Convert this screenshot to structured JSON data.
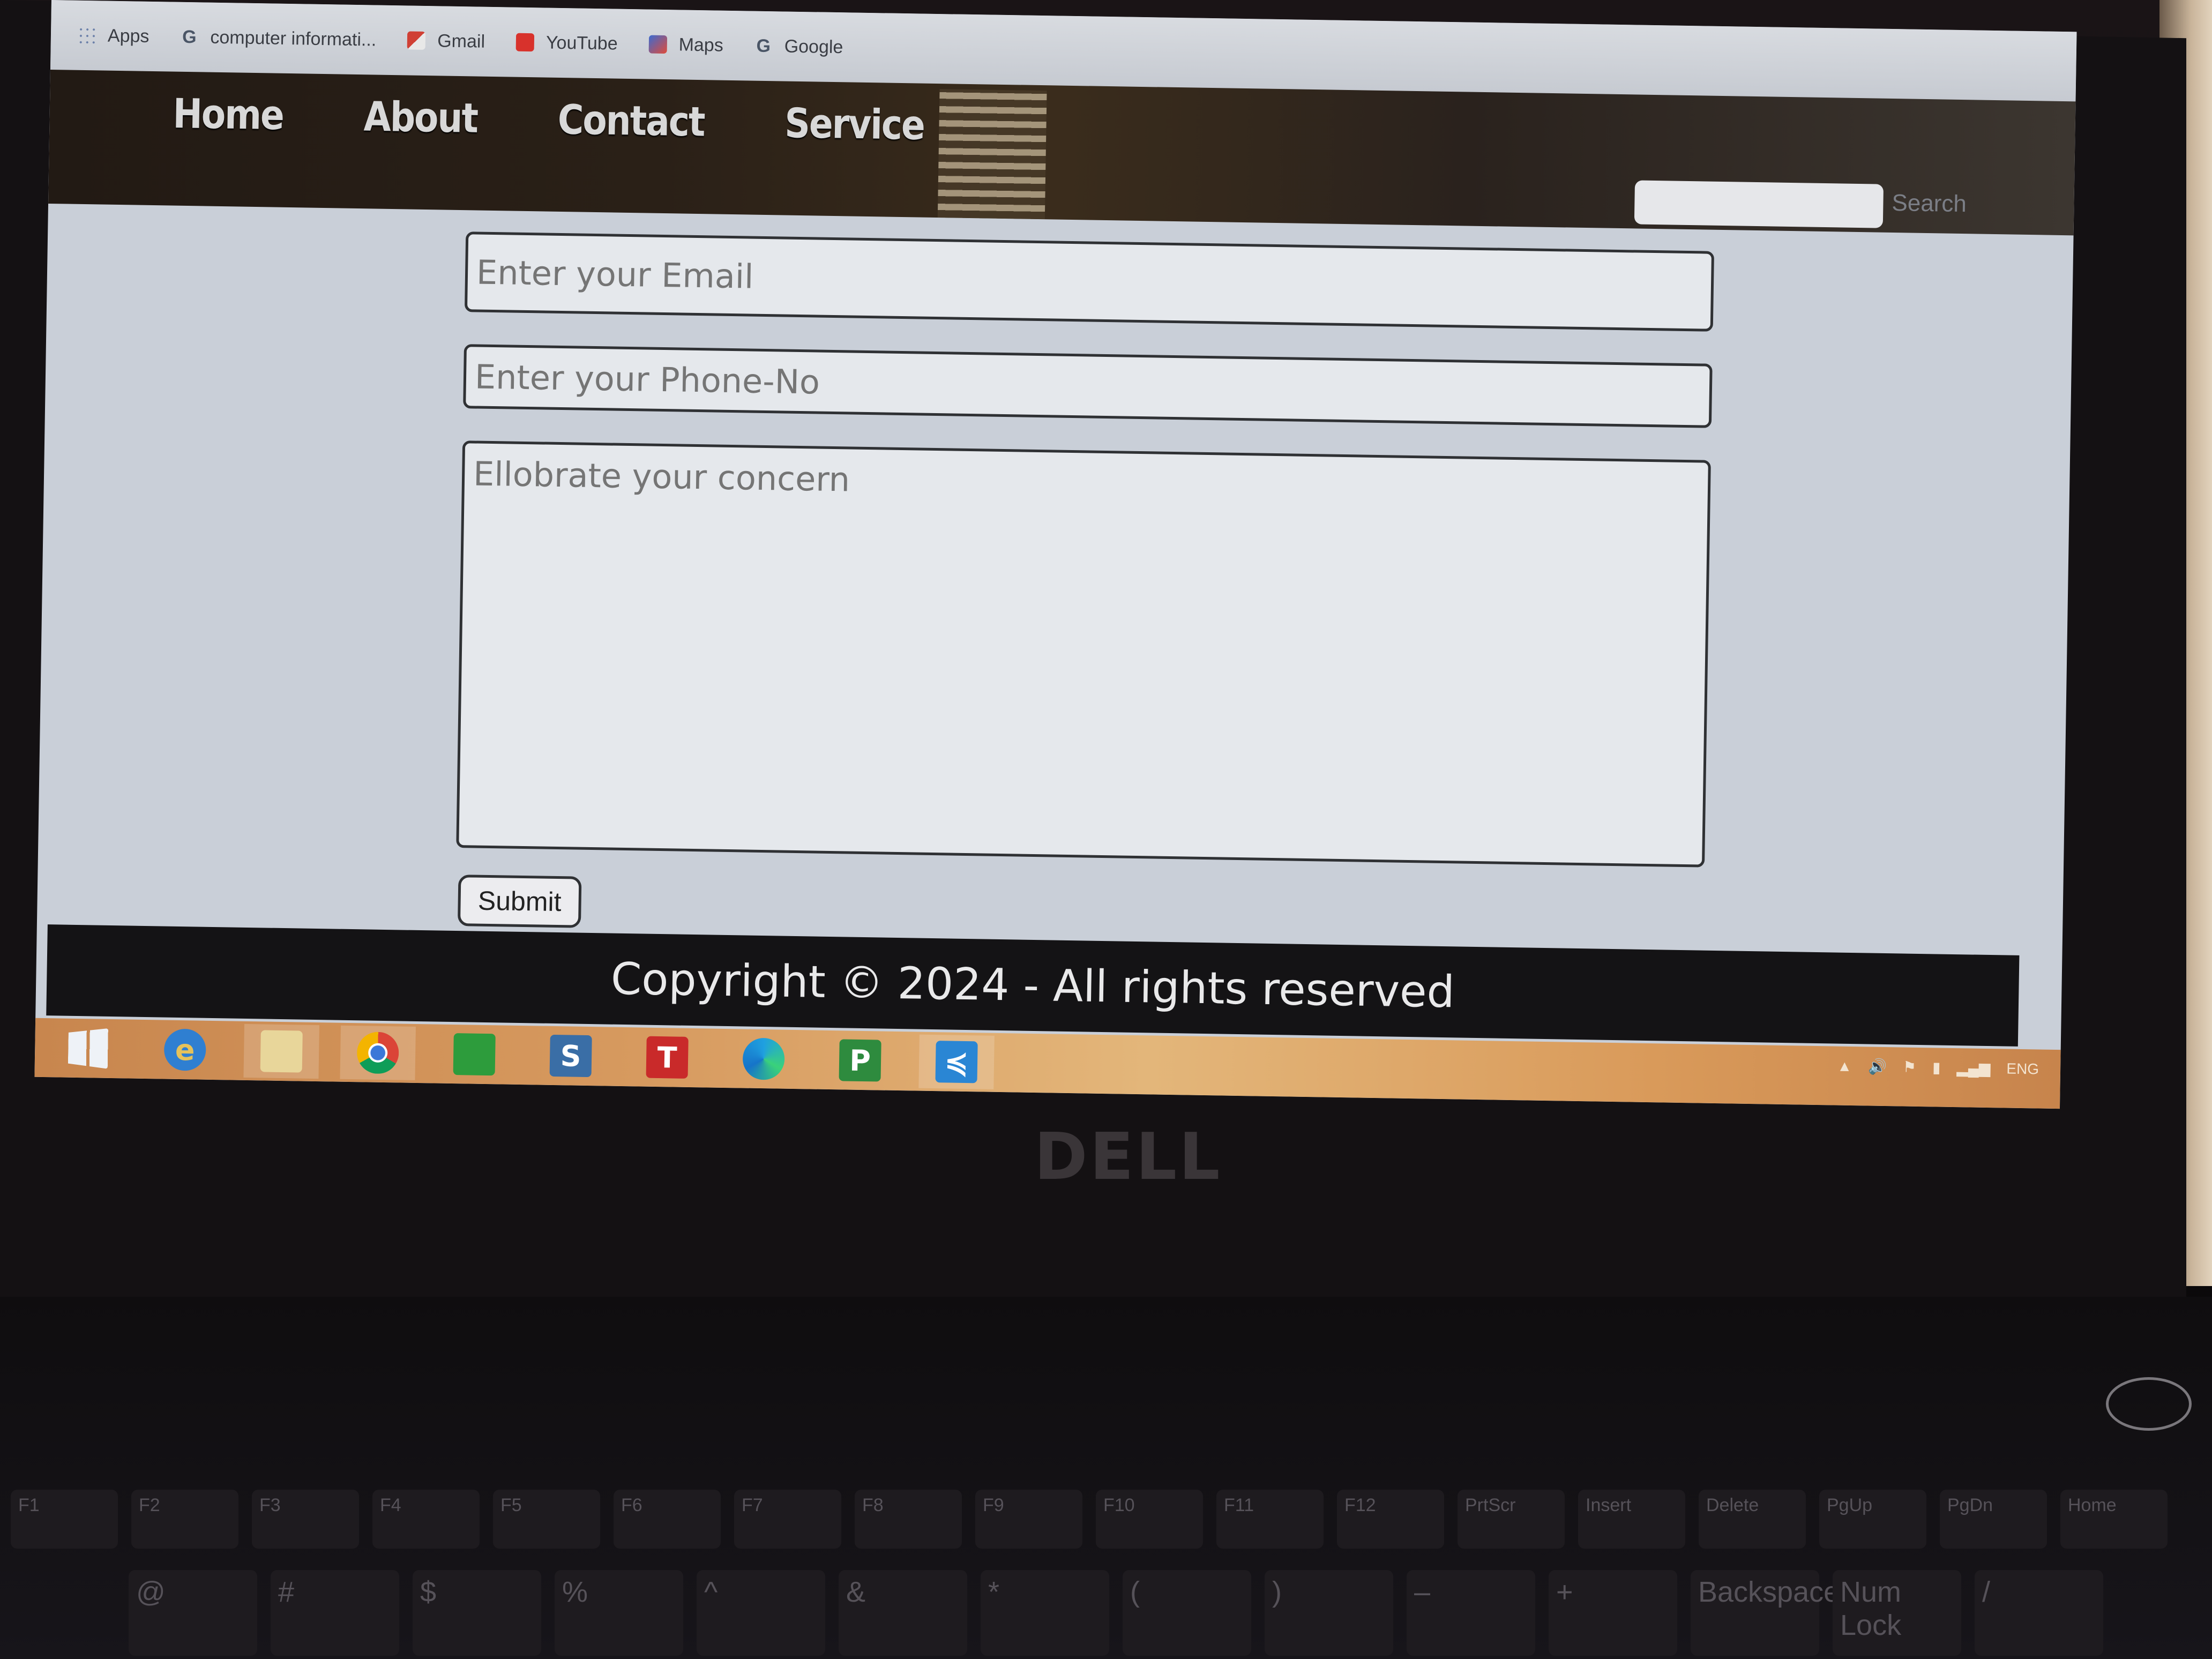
{
  "bookmarks": [
    {
      "label": "Apps",
      "icon": "apps-grid-icon"
    },
    {
      "label": "computer informati...",
      "icon": "google-icon"
    },
    {
      "label": "Gmail",
      "icon": "gmail-icon"
    },
    {
      "label": "YouTube",
      "icon": "youtube-icon"
    },
    {
      "label": "Maps",
      "icon": "maps-icon"
    },
    {
      "label": "Google",
      "icon": "google-icon"
    }
  ],
  "nav": {
    "items": [
      "Home",
      "About",
      "Contact",
      "Service"
    ]
  },
  "search": {
    "placeholder": "",
    "button_label": "Search"
  },
  "form": {
    "email_placeholder": "Enter your Email",
    "phone_placeholder": "Enter your Phone-No",
    "concern_placeholder": "Ellobrate your concern",
    "submit_label": "Submit"
  },
  "footer": {
    "copyright": "Copyright © 2024 - All rights reserved"
  },
  "taskbar": {
    "apps": [
      "windows-start-icon",
      "internet-explorer-icon",
      "file-explorer-icon",
      "chrome-icon",
      "store-icon",
      "s-app-icon",
      "t-app-icon",
      "edge-icon",
      "p-app-icon",
      "vscode-icon"
    ],
    "tray_lang": "ENG"
  },
  "brand_logo": "DELL",
  "keyboard": {
    "fkeys": [
      "F1",
      "F2",
      "F3",
      "F4",
      "F5",
      "F6",
      "F7",
      "F8",
      "F9",
      "F10",
      "F11",
      "F12",
      "PrtScr",
      "Insert",
      "Delete",
      "PgUp",
      "PgDn",
      "Home"
    ],
    "number_row": [
      "@",
      "#",
      "$",
      "%",
      "^",
      "&",
      "*",
      "(",
      ")",
      "–",
      "+",
      "Backspace",
      "Num Lock",
      "/"
    ]
  },
  "colors": {
    "header_dark": "#221a14",
    "footer_bg": "#141315",
    "taskbar_orange": "#d79a5f",
    "page_bg": "#c9cfd8"
  }
}
